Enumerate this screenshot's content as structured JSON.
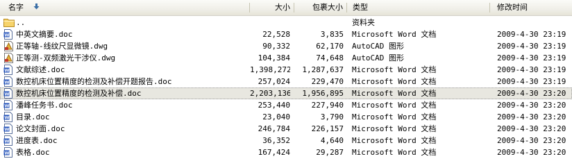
{
  "header": {
    "name": "名字",
    "size": "大小",
    "packed": "包裹大小",
    "type": "类型",
    "modified": "修改时间"
  },
  "colors": {
    "word_icon": "#1f4fb8",
    "folder_icon": "#f2c94c",
    "cad_icon": "#e8b43c",
    "selected_row": "#e8e7e0"
  },
  "files": [
    {
      "name": "..",
      "size": "",
      "packed": "",
      "type": "资料夹",
      "modified": "",
      "icon": "folder-icon"
    },
    {
      "name": "中英文摘要.doc",
      "size": "22,528",
      "packed": "3,835",
      "type": "Microsoft Word 文档",
      "modified": "2009-4-30 23:19",
      "icon": "word-doc-icon"
    },
    {
      "name": "正等轴-线纹尺显微镜.dwg",
      "size": "90,332",
      "packed": "62,170",
      "type": "AutoCAD 图形",
      "modified": "2009-4-30 23:19",
      "icon": "autocad-icon"
    },
    {
      "name": "正等测-双频激光干涉仪.dwg",
      "size": "104,384",
      "packed": "74,648",
      "type": "AutoCAD 图形",
      "modified": "2009-4-30 23:19",
      "icon": "autocad-icon"
    },
    {
      "name": "文献综述.doc",
      "size": "1,398,272",
      "packed": "1,287,637",
      "type": "Microsoft Word 文档",
      "modified": "2009-4-30 23:19",
      "icon": "word-doc-icon"
    },
    {
      "name": "数控机床位置精度的检测及补偿开题报告.doc",
      "size": "257,024",
      "packed": "229,470",
      "type": "Microsoft Word 文档",
      "modified": "2009-4-30 23:19",
      "icon": "word-doc-icon"
    },
    {
      "name": "数控机床位置精度的检测及补偿.doc",
      "size": "2,203,136",
      "packed": "1,956,895",
      "type": "Microsoft Word 文档",
      "modified": "2009-4-30 23:20",
      "icon": "word-doc-icon",
      "selected": true
    },
    {
      "name": "潘峰任务书.doc",
      "size": "253,440",
      "packed": "227,940",
      "type": "Microsoft Word 文档",
      "modified": "2009-4-30 23:20",
      "icon": "word-doc-icon"
    },
    {
      "name": "目录.doc",
      "size": "23,040",
      "packed": "3,790",
      "type": "Microsoft Word 文档",
      "modified": "2009-4-30 23:20",
      "icon": "word-doc-icon"
    },
    {
      "name": "论文封面.doc",
      "size": "246,784",
      "packed": "226,157",
      "type": "Microsoft Word 文档",
      "modified": "2009-4-30 23:20",
      "icon": "word-doc-icon"
    },
    {
      "name": "进度表.doc",
      "size": "36,352",
      "packed": "4,640",
      "type": "Microsoft Word 文档",
      "modified": "2009-4-30 23:20",
      "icon": "word-doc-icon"
    },
    {
      "name": "表格.doc",
      "size": "167,424",
      "packed": "29,287",
      "type": "Microsoft Word 文档",
      "modified": "2009-4-30 23:20",
      "icon": "word-doc-icon"
    }
  ]
}
